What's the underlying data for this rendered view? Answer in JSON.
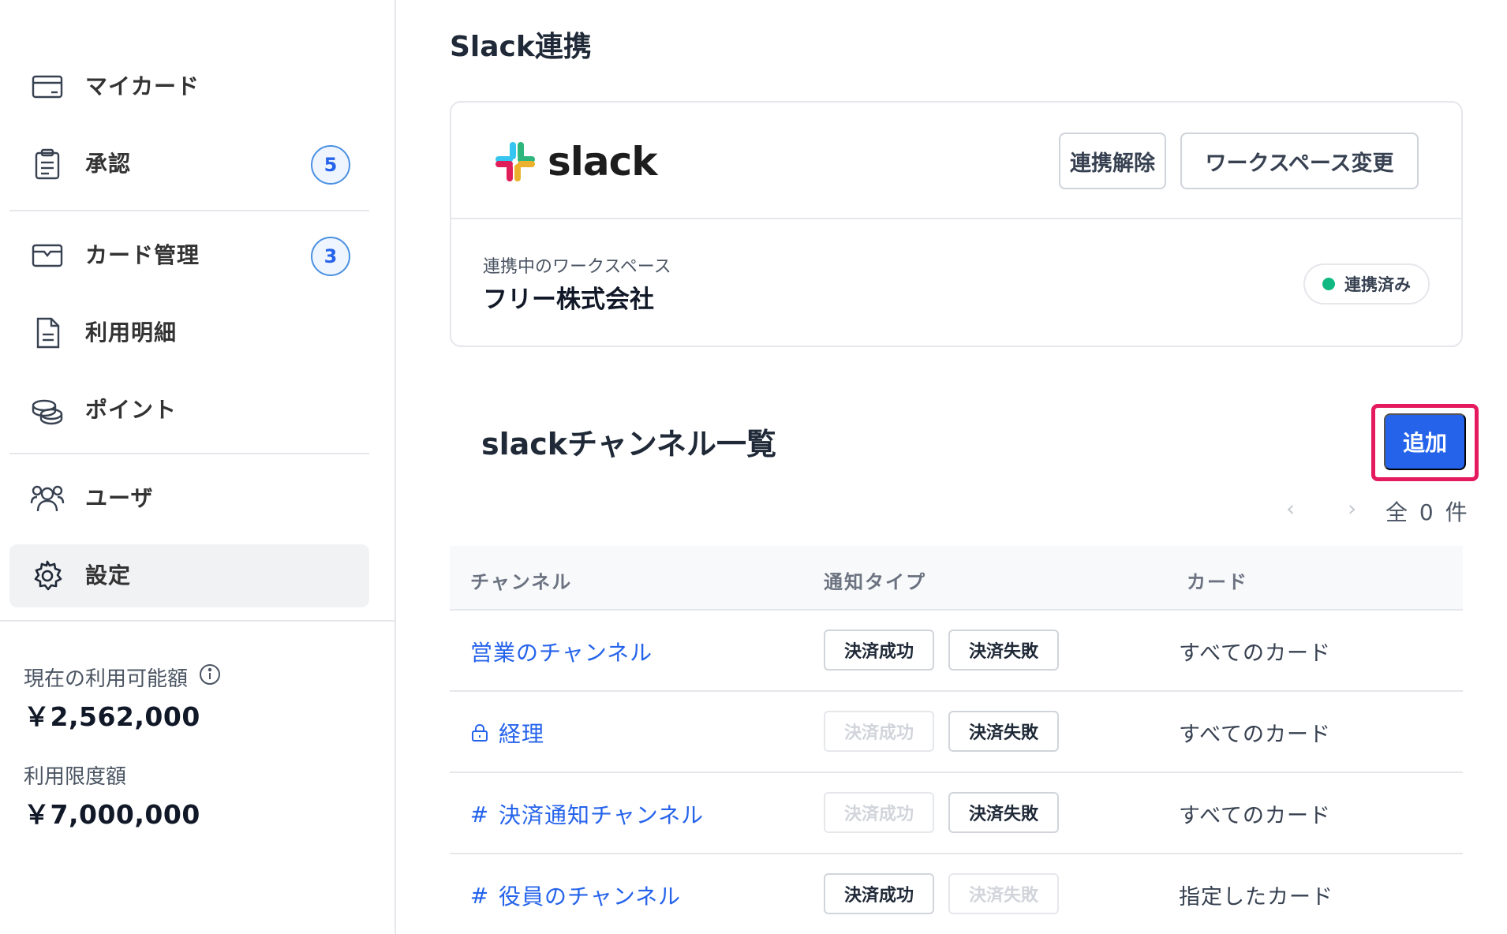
{
  "sidebar": {
    "items": [
      {
        "label": "マイカード",
        "icon": "credit-card-icon"
      },
      {
        "label": "承認",
        "icon": "clipboard-icon",
        "badge": "5"
      },
      {
        "label": "カード管理",
        "icon": "card-folder-icon",
        "badge": "3"
      },
      {
        "label": "利用明細",
        "icon": "document-icon"
      },
      {
        "label": "ポイント",
        "icon": "coins-icon"
      },
      {
        "label": "ユーザ",
        "icon": "users-icon"
      },
      {
        "label": "設定",
        "icon": "gear-icon",
        "active": true
      }
    ],
    "available_label": "現在の利用可能額",
    "available_value": "￥2,562,000",
    "limit_label": "利用限度額",
    "limit_value": "￥7,000,000"
  },
  "page": {
    "title": "Slack連携"
  },
  "integration": {
    "logo_text": "slack",
    "disconnect_label": "連携解除",
    "change_workspace_label": "ワークスペース変更",
    "workspace_label": "連携中のワークスペース",
    "workspace_name": "フリー株式会社",
    "status_label": "連携済み",
    "status_color": "#10b981"
  },
  "channels": {
    "section_title": "slackチャンネル一覧",
    "add_label": "追加",
    "pager_prev": "‹",
    "pager_next": "›",
    "count_label": "全 0 件",
    "columns": [
      "チャンネル",
      "通知タイプ",
      "カード"
    ],
    "rows": [
      {
        "prefix": "",
        "name": "営業のチャンネル",
        "success": "決済成功",
        "success_enabled": true,
        "failure": "決済失敗",
        "failure_enabled": true,
        "card": "すべてのカード"
      },
      {
        "prefix": "lock",
        "name": "経理",
        "success": "決済成功",
        "success_enabled": false,
        "failure": "決済失敗",
        "failure_enabled": true,
        "card": "すべてのカード"
      },
      {
        "prefix": "#",
        "name": "決済通知チャンネル",
        "success": "決済成功",
        "success_enabled": false,
        "failure": "決済失敗",
        "failure_enabled": true,
        "card": "すべてのカード"
      },
      {
        "prefix": "#",
        "name": "役員のチャンネル",
        "success": "決済成功",
        "success_enabled": true,
        "failure": "決済失敗",
        "failure_enabled": false,
        "card": "指定したカード"
      }
    ]
  },
  "colors": {
    "primary": "#2563eb",
    "highlight": "#e5195e"
  }
}
